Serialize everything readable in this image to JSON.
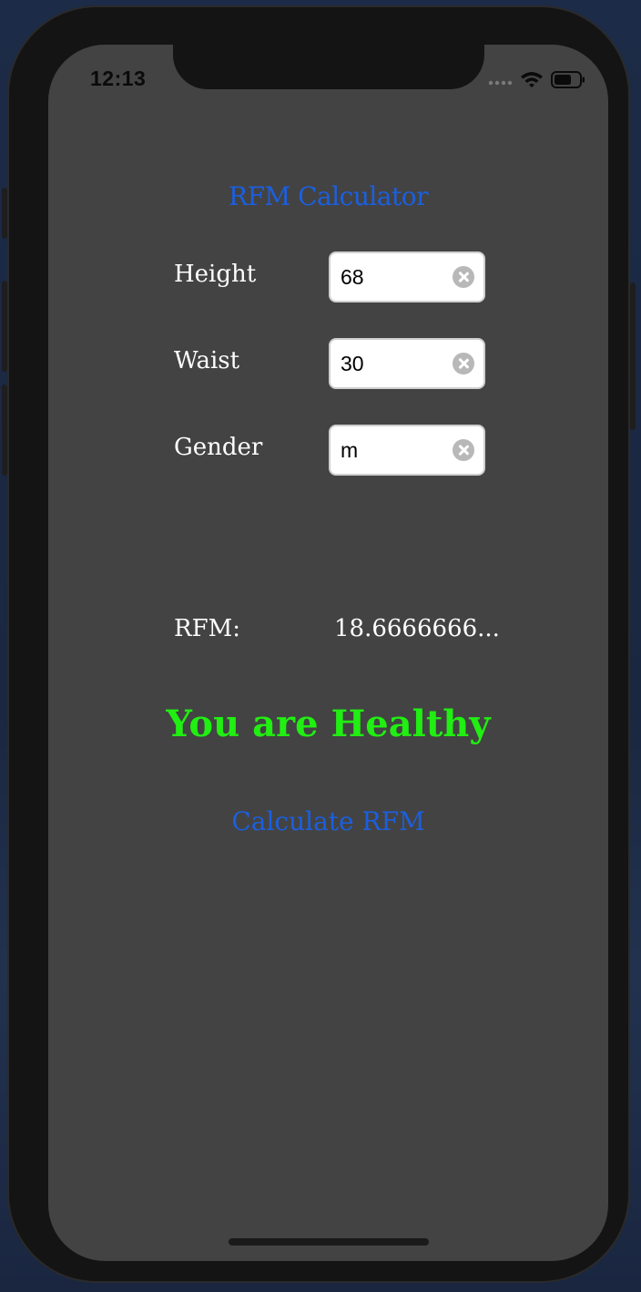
{
  "status_bar": {
    "time": "12:13",
    "icons": [
      "signal-dots-icon",
      "wifi-icon",
      "battery-icon"
    ]
  },
  "app": {
    "title": "RFM Calculator",
    "fields": [
      {
        "label": "Height",
        "value": "68"
      },
      {
        "label": "Waist",
        "value": "30"
      },
      {
        "label": "Gender",
        "value": "m"
      }
    ],
    "result": {
      "label": "RFM:",
      "value": "18.6666666..."
    },
    "verdict": "You are Healthy",
    "calculate_button": "Calculate RFM"
  },
  "colors": {
    "screen_background": "#434343",
    "accent_blue": "#1b5fe0",
    "healthy_green": "#21ee12",
    "text_white": "#ffffff"
  }
}
